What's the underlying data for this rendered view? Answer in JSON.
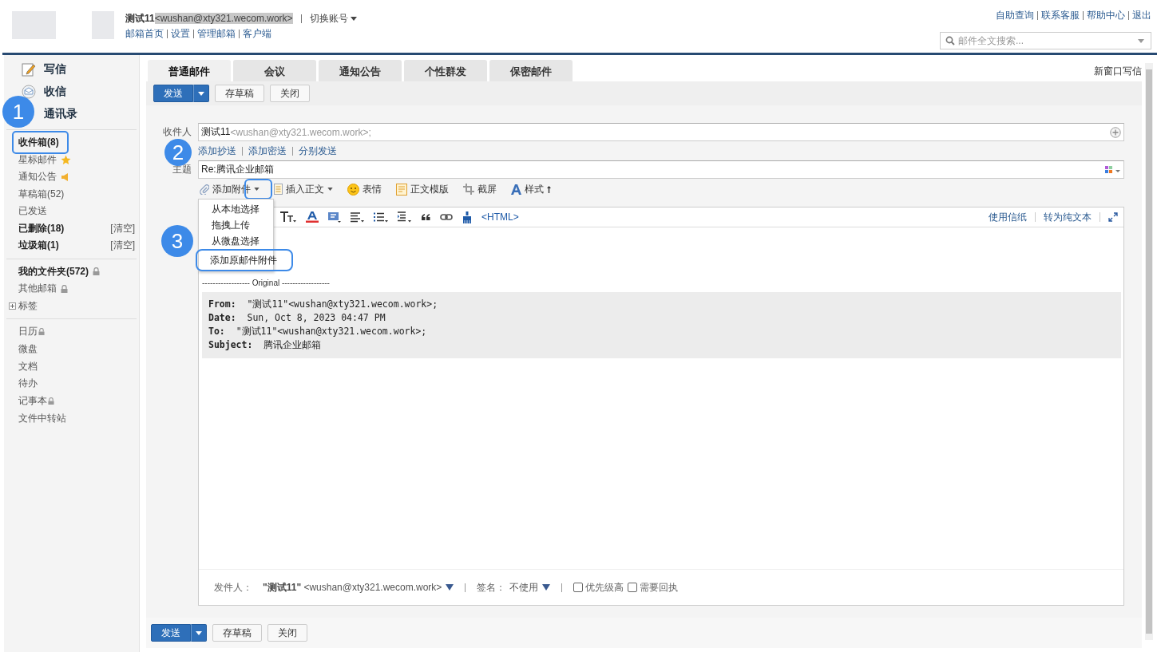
{
  "header": {
    "user_name": "测试11",
    "user_email": "<wushan@xty321.wecom.work>",
    "switch_account": "切换账号",
    "nav_links": [
      "邮箱首页",
      "设置",
      "管理邮箱",
      "客户端"
    ],
    "top_links": [
      "自助查询",
      "联系客服",
      "帮助中心",
      "退出"
    ],
    "search": {
      "placeholder": "邮件全文搜索..."
    }
  },
  "sidebar": {
    "actions": [
      {
        "label": "写信",
        "kind": "compose"
      },
      {
        "label": "收信",
        "kind": "receive"
      },
      {
        "label": "通讯录",
        "kind": "contacts"
      }
    ],
    "folders": [
      {
        "label": "收件箱(8)",
        "unread": true,
        "kind": "plain"
      },
      {
        "label": "星标邮件",
        "unread": false,
        "kind": "star"
      },
      {
        "label": "通知公告",
        "unread": false,
        "kind": "speaker"
      },
      {
        "label": "草稿箱(52)",
        "unread": false,
        "kind": "plain"
      },
      {
        "label": "已发送",
        "unread": false,
        "kind": "plain"
      },
      {
        "label": "已删除(18)",
        "unread": true,
        "kind": "plain",
        "action": "[清空]"
      },
      {
        "label": "垃圾箱(1)",
        "unread": true,
        "kind": "plain",
        "action": "[清空]"
      }
    ],
    "my_folders": [
      {
        "label": "我的文件夹(572)",
        "unread": true,
        "kind": "locked"
      },
      {
        "label": "其他邮箱",
        "unread": false,
        "kind": "locked"
      },
      {
        "label": "标签",
        "unread": false,
        "kind": "expandable"
      }
    ],
    "apps": [
      {
        "label": "日历",
        "kind": "locked"
      },
      {
        "label": "微盘",
        "kind": "plain"
      },
      {
        "label": "文档",
        "kind": "plain"
      },
      {
        "label": "待办",
        "kind": "plain"
      },
      {
        "label": "记事本",
        "kind": "locked"
      },
      {
        "label": "文件中转站",
        "kind": "plain"
      }
    ]
  },
  "compose": {
    "tabs": [
      {
        "label": "普通邮件",
        "selected": true
      },
      {
        "label": "会议",
        "selected": false
      },
      {
        "label": "通知公告",
        "selected": false
      },
      {
        "label": "个性群发",
        "selected": false
      },
      {
        "label": "保密邮件",
        "selected": false
      }
    ],
    "new_window_link": "新窗口写信",
    "toolbar": {
      "send": "发送",
      "draft": "存草稿",
      "close": "关闭"
    },
    "to": {
      "label": "收件人",
      "name": "测试11",
      "address": "<wushan@xty321.wecom.work>;"
    },
    "cc_links": [
      "添加抄送",
      "添加密送",
      "分别发送"
    ],
    "subject": {
      "label": "主题",
      "value": "Re:腾讯企业邮箱"
    },
    "insert_tools": [
      {
        "label": "添加附件",
        "kind": "attach",
        "dropdown": true
      },
      {
        "label": "插入正文",
        "kind": "doc",
        "dropdown": true
      },
      {
        "label": "表情",
        "kind": "emoji",
        "dropdown": false
      },
      {
        "label": "正文模版",
        "kind": "template",
        "dropdown": false
      },
      {
        "label": "截屏",
        "kind": "screenshot",
        "dropdown": false
      },
      {
        "label": "样式",
        "kind": "style",
        "dropdown": false
      }
    ],
    "attach_menu": [
      "从本地选择",
      "拖拽上传",
      "从微盘选择",
      "添加原邮件附件"
    ],
    "editor": {
      "tools": [
        {
          "kind": "text-size"
        },
        {
          "kind": "font-color"
        },
        {
          "kind": "highlight"
        },
        {
          "kind": "align"
        },
        {
          "kind": "bullets"
        },
        {
          "kind": "numbering"
        },
        {
          "kind": "quote"
        },
        {
          "kind": "link"
        },
        {
          "kind": "brush"
        }
      ],
      "html_toggle": "<HTML>",
      "right_links": [
        "使用信纸",
        "转为纯文本"
      ],
      "original_divider": "------------------ Original ------------------",
      "quote": [
        {
          "key": "From:",
          "value": "\"测试11\"<wushan@xty321.wecom.work>;"
        },
        {
          "key": "Date:",
          "value": "Sun, Oct 8, 2023 04:47 PM"
        },
        {
          "key": "To:",
          "value": "\"测试11\"<wushan@xty321.wecom.work>;"
        },
        {
          "key": "Subject:",
          "value": "腾讯企业邮箱"
        }
      ]
    },
    "footer": {
      "sender_label": "发件人：",
      "sender_name": "\"测试11\"",
      "sender_address": "<wushan@xty321.wecom.work>",
      "signature_label": "签名：",
      "signature_value": "不使用",
      "options": [
        {
          "label": "优先级高",
          "checked": false
        },
        {
          "label": "需要回执",
          "checked": false
        }
      ]
    },
    "bottom_toolbar": {
      "send": "发送",
      "draft": "存草稿",
      "close": "关闭"
    }
  },
  "callouts": [
    {
      "number": "1"
    },
    {
      "number": "2"
    },
    {
      "number": "3"
    }
  ]
}
